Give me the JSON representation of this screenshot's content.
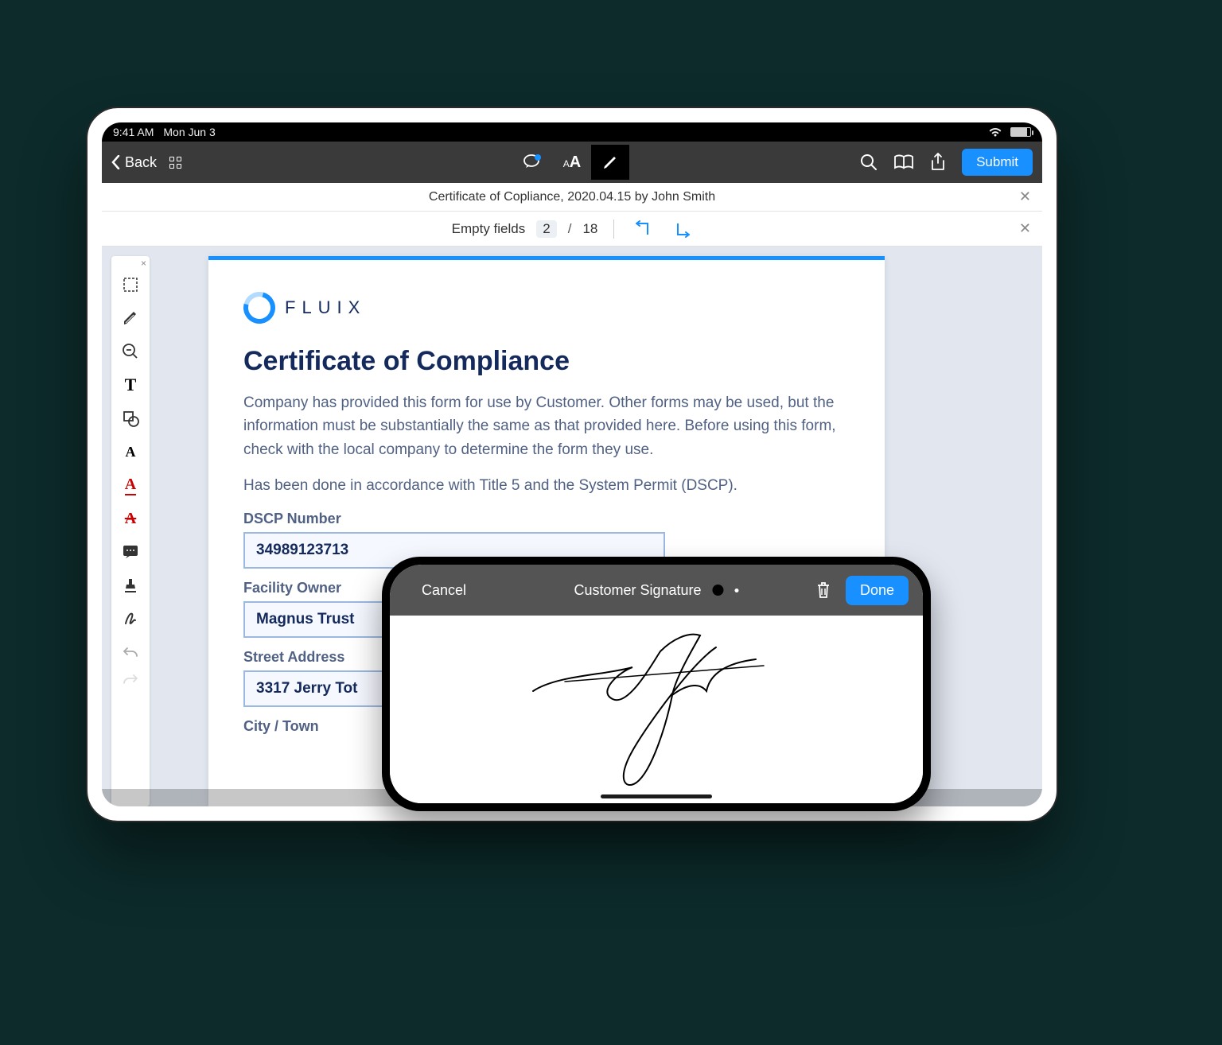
{
  "statusbar": {
    "time": "9:41 AM",
    "date": "Mon Jun 3"
  },
  "toolbar": {
    "back_label": "Back",
    "submit_label": "Submit"
  },
  "doc_title": "Certificate of Copliance, 2020.04.15 by John Smith",
  "fields_bar": {
    "label": "Empty fields",
    "current": "2",
    "total": "18"
  },
  "document": {
    "brand": "FLUIX",
    "heading": "Certificate of Compliance",
    "para1": "Company has provided this form for use by Customer. Other forms may be used, but the information must be substantially the same as that provided here. Before using this form, check with the local company to determine the form they use.",
    "para2": "Has been done in accordance with Title 5 and the System Permit (DSCP).",
    "fields": {
      "dscp_label": "DSCP Number",
      "dscp_value": "34989123713",
      "owner_label": "Facility Owner",
      "owner_value": "Magnus Trust",
      "street_label": "Street Address",
      "street_value": "3317 Jerry Tot",
      "city_label": "City / Town"
    }
  },
  "signature": {
    "cancel": "Cancel",
    "title": "Customer Signature",
    "done": "Done"
  }
}
